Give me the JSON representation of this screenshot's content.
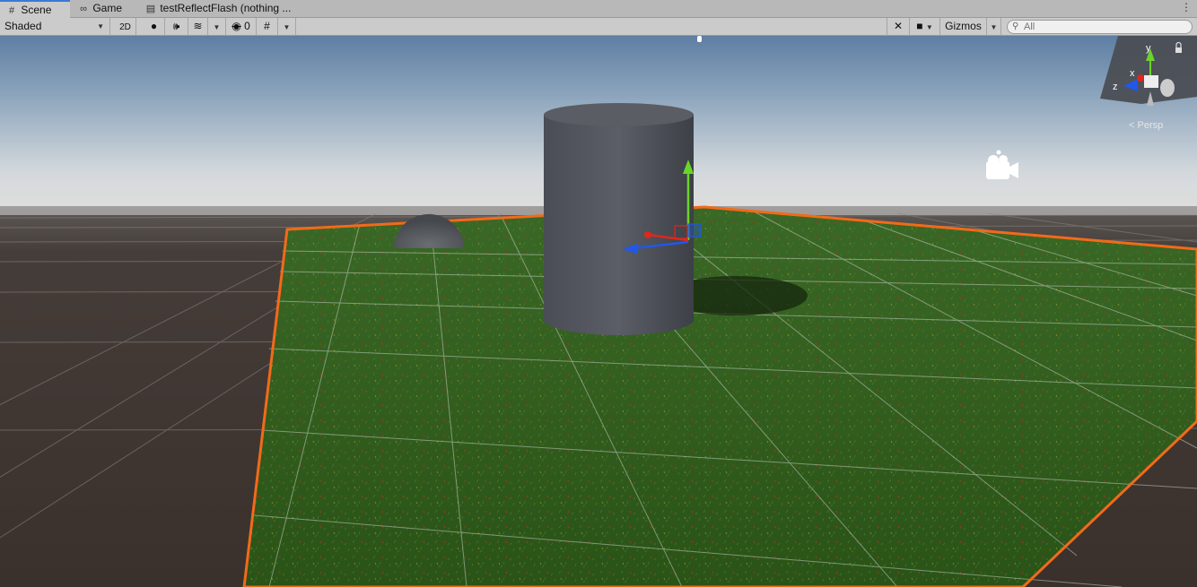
{
  "tabs": [
    {
      "label": "Scene",
      "icon": "scene-grid-icon",
      "active": true
    },
    {
      "label": "Game",
      "icon": "game-controller-icon",
      "active": false
    },
    {
      "label": "testReflectFlash (nothing ...",
      "icon": "script-file-icon",
      "active": false
    }
  ],
  "toolbar": {
    "draw_mode": "Shaded",
    "mode_2d": "2D",
    "hidden_count": "0",
    "gizmos_label": "Gizmos",
    "search_placeholder": "All"
  },
  "scene_gizmo": {
    "x_label": "x",
    "y_label": "y",
    "z_label": "z",
    "projection": "Persp"
  },
  "colors": {
    "selection_outline": "#f26a1b",
    "axis_x": "#e0261d",
    "axis_y": "#6bd42a",
    "axis_z": "#2257e8",
    "sky_top": "#5f7fa4",
    "horizon": "#dcdcdc",
    "ground": "#3f3632",
    "grass": "#2f5a1c"
  }
}
